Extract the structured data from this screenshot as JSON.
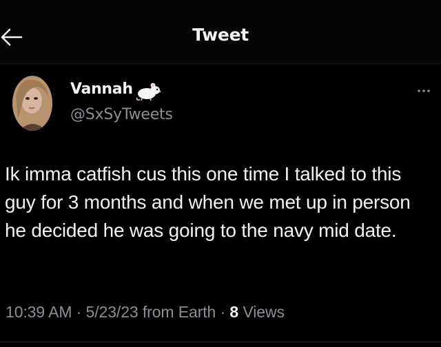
{
  "header": {
    "title": "Tweet",
    "back_icon": "arrow-left-icon"
  },
  "author": {
    "display_name": "Vannah",
    "emoji_icon": "rat-emoji-icon",
    "handle": "@SxSyTweets",
    "avatar": "profile-photo"
  },
  "more_icon": "more-horizontal-icon",
  "tweet": {
    "text": "Ik imma catfish cus this one time I talked to this guy for 3 months and when we met up in person he decided he was going to the navy mid date."
  },
  "meta": {
    "time": "10:39 AM",
    "separator": "·",
    "date": "5/23/23",
    "source": "from Earth",
    "views_count": "8",
    "views_label": "Views"
  },
  "colors": {
    "background": "#000000",
    "primary_text": "#f2f2f2",
    "secondary_text": "#8b8f93"
  }
}
